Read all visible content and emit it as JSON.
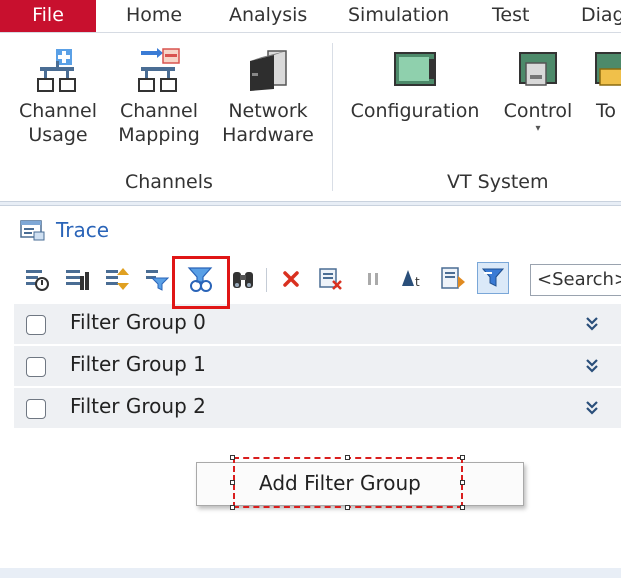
{
  "menubar": {
    "file": "File",
    "items": [
      "Home",
      "Analysis",
      "Simulation",
      "Test",
      "Diag"
    ]
  },
  "ribbon": {
    "channels_group": {
      "label": "Channels",
      "buttons": [
        {
          "line1": "Channel",
          "line2": "Usage",
          "icon": "channel-usage-icon"
        },
        {
          "line1": "Channel",
          "line2": "Mapping",
          "icon": "channel-mapping-icon"
        },
        {
          "line1": "Network",
          "line2": "Hardware",
          "icon": "network-hardware-icon"
        }
      ]
    },
    "vt_group": {
      "label": "VT System",
      "buttons": [
        {
          "line1": "Configuration",
          "line2": "",
          "icon": "vt-configuration-icon"
        },
        {
          "line1": "Control",
          "line2": "",
          "icon": "vt-control-icon"
        },
        {
          "line1": "To",
          "line2": "",
          "icon": "vt-tools-icon"
        }
      ]
    }
  },
  "trace": {
    "title": "Trace",
    "search_placeholder": "<Search>"
  },
  "filter_groups": [
    {
      "label": "Filter Group 0",
      "checked": false
    },
    {
      "label": "Filter Group 1",
      "checked": false
    },
    {
      "label": "Filter Group 2",
      "checked": false
    }
  ],
  "context_menu": {
    "item": "Add Filter Group"
  },
  "colors": {
    "file_tab": "#c8102e",
    "trace_title": "#2a64b8",
    "highlight": "#e01616"
  }
}
